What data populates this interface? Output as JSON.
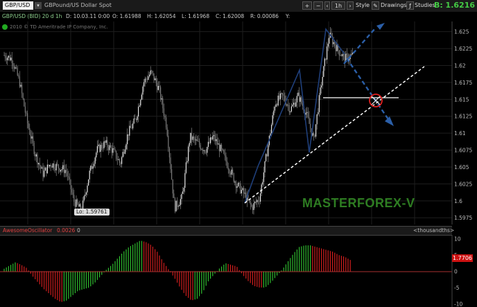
{
  "toolbar": {
    "symbol": "GBP/USD",
    "description": "GBPound/US Dollar Spot",
    "timeframe": "1h",
    "style_label": "Style",
    "drawings_label": "Drawings",
    "studies_label": "Studies",
    "bid_text": "B: 1.6216"
  },
  "info": {
    "series": "GBP/USD (BID) 20 d 1h",
    "date": "D: 10.03.11 0:00",
    "open": "O: 1.61988",
    "high": "H: 1.62054",
    "low": "L: 1.61968",
    "close": "C: 1.62008",
    "change": "R: 0.00086",
    "extra": "Y:"
  },
  "copyright": "2010 © TD Ameritrade IP Company, Inc.",
  "low_marker": "Lo: 1.59761",
  "brand": "MASTERFOREX-V",
  "oscillator": {
    "name": "AwesomeOscillator",
    "value": "0.0026",
    "zero": "0",
    "unit": "<thousandths>",
    "current_badge": "1.7706"
  },
  "colors": {
    "up": "#33cc33",
    "down": "#e02020",
    "pattern": "#1f3f7a",
    "arrow": "#2b5fa8",
    "brand": "#2e7d22"
  },
  "chart_data": {
    "type": "candlestick",
    "price_axis": {
      "ticks": [
        "1.625",
        "1.6225",
        "1.62",
        "1.6175",
        "1.615",
        "1.6125",
        "1.61",
        "1.6075",
        "1.605",
        "1.6025",
        "1.6",
        "1.5975"
      ],
      "range": [
        1.5965,
        1.6265
      ]
    },
    "closes": [
      1.6215,
      1.621,
      1.6175,
      1.6115,
      1.607,
      1.604,
      1.6055,
      1.605,
      1.6045,
      1.6,
      1.5985,
      1.604,
      1.6075,
      1.6085,
      1.6075,
      1.6055,
      1.61,
      1.612,
      1.6175,
      1.619,
      1.6165,
      1.611,
      1.599,
      1.6005,
      1.6095,
      1.6085,
      1.6075,
      1.6095,
      1.6075,
      1.605,
      1.6025,
      1.601,
      1.599,
      1.6005,
      1.6075,
      1.6145,
      1.6155,
      1.6135,
      1.6155,
      1.613,
      1.609,
      1.6175,
      1.6245,
      1.6225,
      1.621,
      1.6215
    ],
    "oscillator_axis": {
      "ticks": [
        "10",
        "5",
        "0",
        "-5",
        "-10"
      ],
      "range": [
        -11,
        11
      ]
    },
    "oscillator": [
      0.8,
      1.8,
      2.8,
      2,
      1,
      -1.5,
      -3.5,
      -5.5,
      -7,
      -8.5,
      -9.5,
      -9,
      -7.5,
      -6,
      -5.5,
      -5,
      -3.5,
      -1.5,
      0.5,
      2,
      4,
      6,
      7.5,
      8.5,
      9.5,
      9,
      8,
      6,
      3,
      0.5,
      -2,
      -5,
      -7.5,
      -9,
      -8.5,
      -6.5,
      -3,
      -1,
      1,
      2.5,
      2,
      1.5,
      -1,
      -3,
      -4.5,
      -5,
      -5,
      -3.5,
      -1.5,
      0.5,
      3,
      5.5,
      7.5,
      8,
      8,
      7.5,
      7,
      6.5,
      6,
      5,
      4.5,
      3.5
    ]
  }
}
